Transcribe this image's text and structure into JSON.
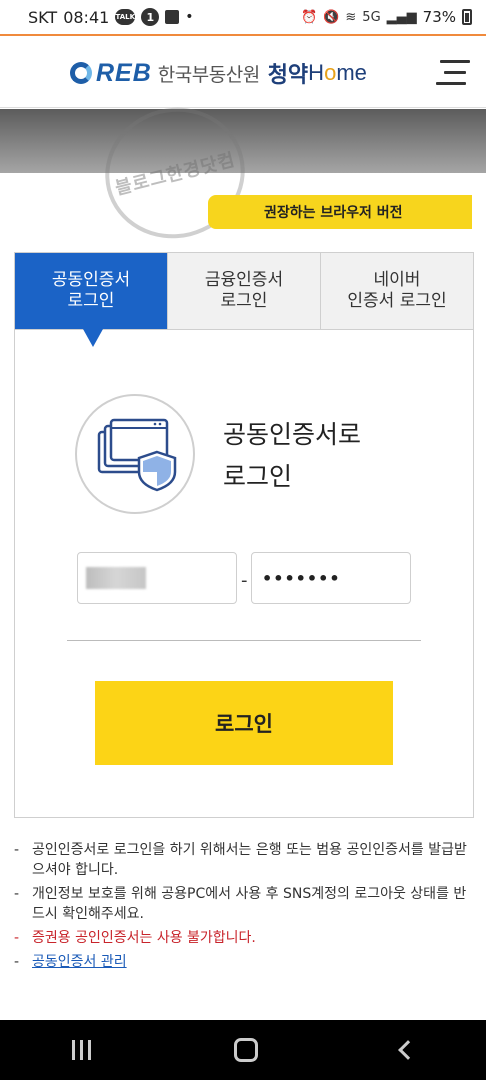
{
  "status_bar": {
    "carrier": "SKT",
    "time": "08:41",
    "talk_label": "TALK",
    "notification_count": "1",
    "network": "5G",
    "battery": "73%"
  },
  "header": {
    "logo_reb": "REB",
    "logo_org": "한국부동산원",
    "logo_cheongyak": "청약",
    "logo_home_h": "H",
    "logo_home_o": "o",
    "logo_home_me": "me"
  },
  "banner": {
    "watermark_text": "블로그한경닷컴"
  },
  "browser_note": {
    "label": "권장하는 브라우저 버전"
  },
  "tabs": [
    {
      "line1": "공동인증서",
      "line2": "로그인",
      "active": true
    },
    {
      "line1": "금융인증서",
      "line2": "로그인",
      "active": false
    },
    {
      "line1": "네이버",
      "line2": "인증서 로그인",
      "active": false
    }
  ],
  "login": {
    "title_line1": "공동인증서로",
    "title_line2": "로그인",
    "separator": "-",
    "password_mask": "•••••••",
    "button_label": "로그인"
  },
  "notes": [
    "공인인증서로 로그인을 하기 위해서는 은행 또는 범용 공인인증서를 발급받으셔야 합니다.",
    "개인정보 보호를 위해 공용PC에서 사용 후 SNS계정의 로그아웃 상태를 반드시 확인해주세요.",
    "증권용 공인인증서는 사용 불가합니다.",
    "공동인증서 관리"
  ],
  "colors": {
    "primary_blue": "#1b63c6",
    "yellow": "#fcd416",
    "warning_red": "#c8242b",
    "link_blue": "#1b5bb8"
  },
  "icons": [
    "wifi-icon",
    "signal-icon",
    "alarm-icon",
    "battery-icon",
    "menu-icon",
    "certificate-shield-icon",
    "recent-apps-icon",
    "home-icon",
    "back-icon"
  ]
}
